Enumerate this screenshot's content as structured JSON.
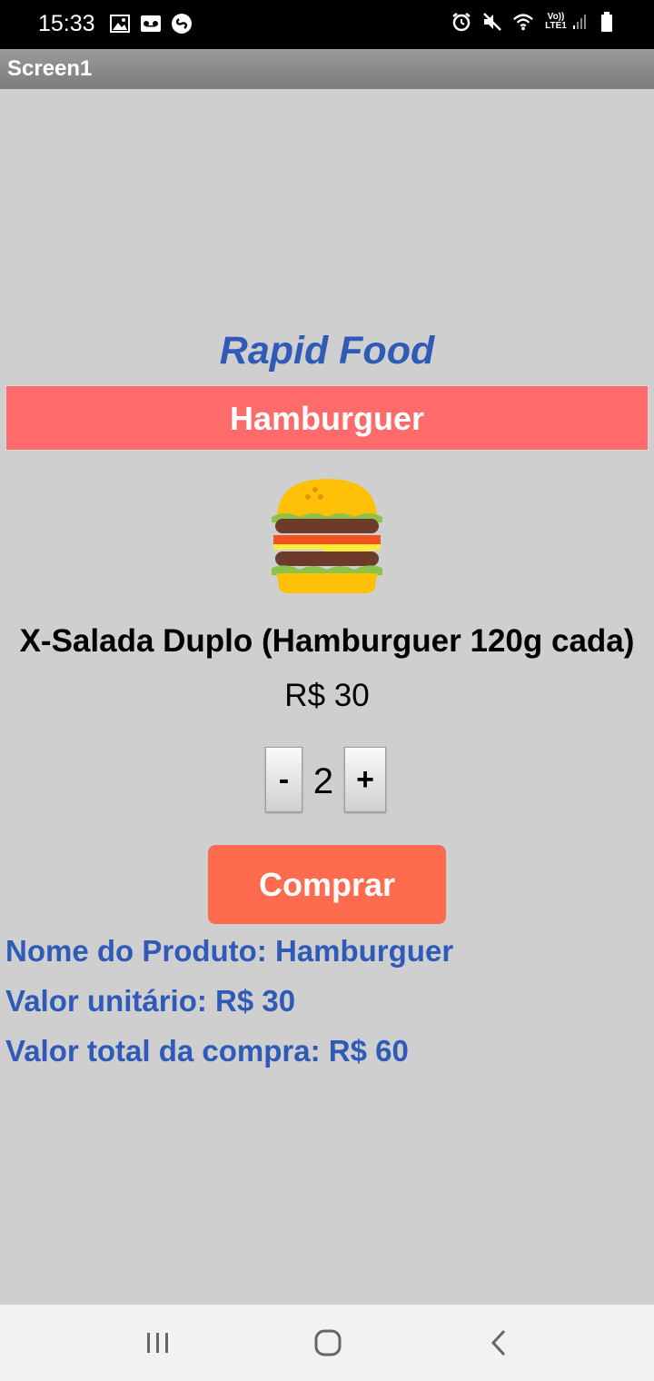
{
  "status_bar": {
    "time": "15:33",
    "left_icons": [
      "image-icon",
      "voicemail-icon",
      "shazam-icon"
    ],
    "right_icons": [
      "alarm-icon",
      "mute-icon",
      "wifi-icon",
      "lte-signal-icon",
      "battery-icon"
    ],
    "lte_label_top": "Vo))",
    "lte_label_bottom": "LTE1"
  },
  "app_bar": {
    "title": "Screen1"
  },
  "main": {
    "brand": "Rapid Food",
    "category": "Hamburguer",
    "product_icon": "hamburger-icon",
    "product_name": "X-Salada Duplo (Hamburguer 120g cada)",
    "price": "R$ 30",
    "stepper": {
      "minus_label": "-",
      "quantity": "2",
      "plus_label": "+"
    },
    "buy_label": "Comprar",
    "summary": {
      "product_line": "Nome do Produto: Hamburguer",
      "unit_price_line": "Valor unitário: R$ 30",
      "total_line": "Valor total da compra: R$ 60"
    }
  },
  "nav_bar": {
    "icons": [
      "recents-icon",
      "home-icon",
      "back-icon"
    ]
  },
  "colors": {
    "accent_blue": "#2f5ab7",
    "category_red": "#ff6b6b",
    "buy_orange": "#ff6b4f",
    "background": "#cfcfcf"
  }
}
